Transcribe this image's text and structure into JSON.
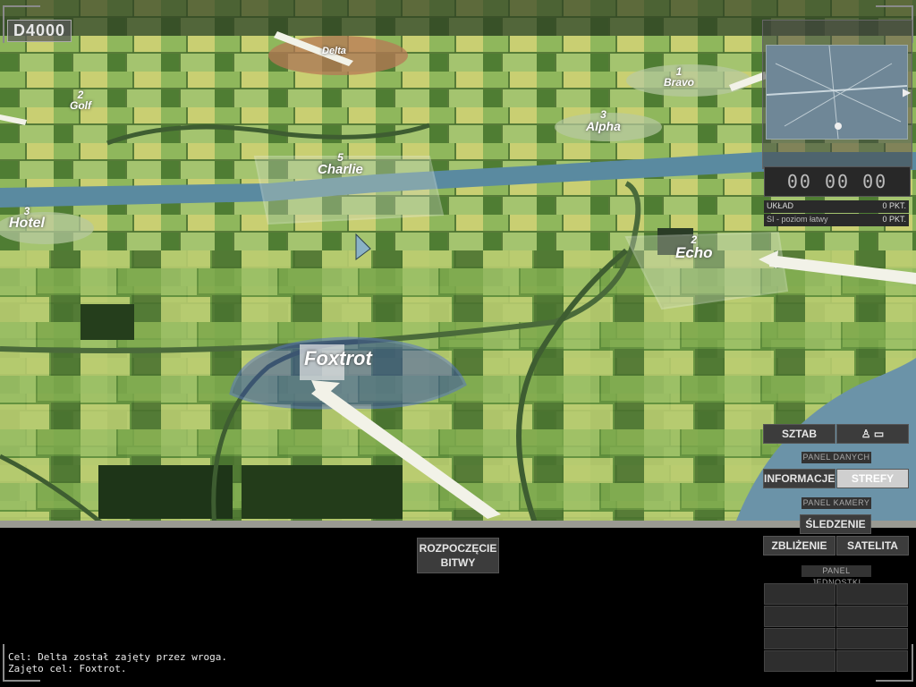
{
  "score": "D4000",
  "zones": [
    {
      "number": "",
      "name": "Delta"
    },
    {
      "number": "1",
      "name": "Bravo"
    },
    {
      "number": "2",
      "name": "Golf"
    },
    {
      "number": "3",
      "name": "Alpha"
    },
    {
      "number": "5",
      "name": "Charlie"
    },
    {
      "number": "3",
      "name": "Hotel"
    },
    {
      "number": "2",
      "name": "Echo"
    },
    {
      "number": "",
      "name": "Foxtrot"
    }
  ],
  "timer": "00 00 00",
  "stats": {
    "layout_label": "UKŁAD",
    "layout_value": "0 PKT.",
    "ai_label": "SI - poziom łatwy",
    "ai_value": "0 PKT."
  },
  "buttons": {
    "sztab": "SZTAB",
    "panel_danych": "PANEL DANYCH",
    "informacje": "INFORMACJE",
    "strefy": "STREFY",
    "panel_kamery": "PANEL KAMERY",
    "sledzenie": "ŚLEDZENIE",
    "zblizenie": "ZBLIŻENIE",
    "satelita": "SATELITA",
    "panel_jednostki": "PANEL JEDNOSTKI",
    "start_line1": "ROZPOCZĘCIE",
    "start_line2": "BITWY"
  },
  "log": [
    "Cel: Delta został zajęty przez wroga.",
    "Zajęto cel: Foxtrot."
  ],
  "colors": {
    "field_dark": "#4e7a34",
    "field_light": "#9cc06a",
    "field_yellow": "#d9d97a",
    "river": "#5a8aa0",
    "panel_bg": "#3c3c3c",
    "active_button": "#cfcfcf",
    "foxtrot_zone": "#3a4fb0"
  }
}
